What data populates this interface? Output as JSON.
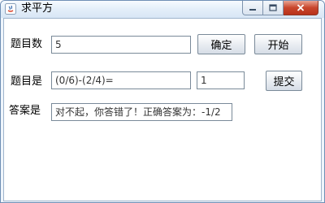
{
  "window": {
    "title": "求平方",
    "controls": {
      "minimize_icon": "minimize-icon",
      "maximize_icon": "maximize-icon",
      "close_icon": "close-icon"
    }
  },
  "form": {
    "count": {
      "label": "题目数",
      "value": "5",
      "confirm_label": "确定",
      "start_label": "开始"
    },
    "question": {
      "label": "题目是",
      "value": "(0/6)-(2/4)=",
      "answer_value": "1",
      "submit_label": "提交"
    },
    "result": {
      "label": "答案是",
      "value": "对不起，你答错了！正确答案为：-1/2"
    }
  }
}
